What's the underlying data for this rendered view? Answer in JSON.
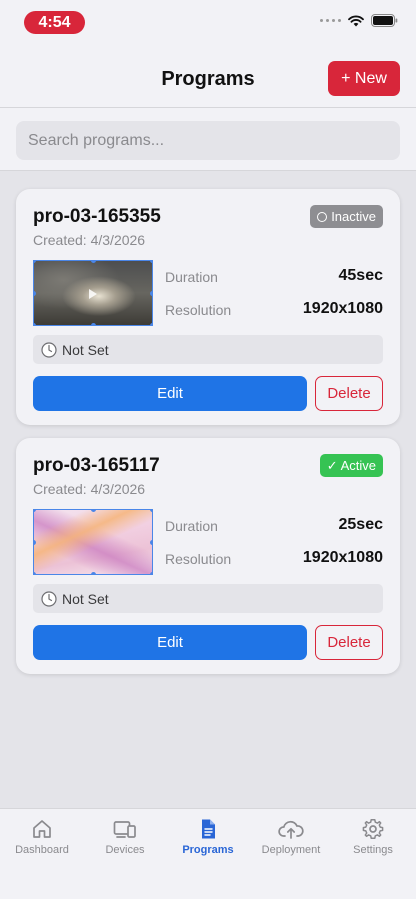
{
  "status_bar": {
    "time": "4:54",
    "icons": [
      "signal-icon",
      "wifi-icon",
      "battery-icon"
    ]
  },
  "header": {
    "title": "Programs",
    "new_label": "+ New"
  },
  "search": {
    "placeholder": "Search programs..."
  },
  "programs": [
    {
      "name": "pro-03-165355",
      "created": "Created: 4/3/2026",
      "status": "Inactive",
      "duration_label": "Duration",
      "duration": "45sec",
      "resolution_label": "Resolution",
      "resolution": "1920x1080",
      "schedule": "Not Set",
      "edit_label": "Edit",
      "delete_label": "Delete"
    },
    {
      "name": "pro-03-165117",
      "created": "Created: 4/3/2026",
      "status": "✓ Active",
      "duration_label": "Duration",
      "duration": "25sec",
      "resolution_label": "Resolution",
      "resolution": "1920x1080",
      "schedule": "Not Set",
      "edit_label": "Edit",
      "delete_label": "Delete"
    }
  ],
  "tabbar": {
    "items": [
      {
        "label": "Dashboard",
        "icon": "home-icon"
      },
      {
        "label": "Devices",
        "icon": "devices-icon"
      },
      {
        "label": "Programs",
        "icon": "document-icon",
        "active": true
      },
      {
        "label": "Deployment",
        "icon": "cloud-upload-icon"
      },
      {
        "label": "Settings",
        "icon": "gear-icon"
      }
    ]
  },
  "colors": {
    "accent_red": "#d8263a",
    "primary_blue": "#1f74e6",
    "active_green": "#36c353",
    "inactive_gray": "#8e8e92",
    "tab_active": "#2a66d6"
  }
}
